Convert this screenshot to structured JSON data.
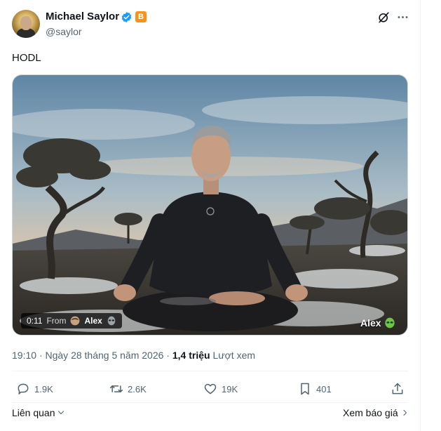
{
  "author": {
    "name": "Michael Saylor",
    "handle": "@saylor",
    "badge_letter": "B"
  },
  "tweet": {
    "text": "HODL"
  },
  "video": {
    "duration": "0:11",
    "from_label": "From",
    "from_name": "Alex",
    "watermark": "Alex"
  },
  "meta": {
    "time": "19:10",
    "separator": "·",
    "date": "Ngày 28 tháng 5 năm 2026",
    "views_count": "1,4 triệu",
    "views_label": "Lượt xem"
  },
  "actions": {
    "replies": "1.9K",
    "reposts": "2.6K",
    "likes": "19K",
    "bookmarks": "401"
  },
  "footer": {
    "related": "Liên quan",
    "quotes": "Xem báo giá"
  },
  "colors": {
    "verified": "#1d9bf0",
    "btc": "#f7931a",
    "muted": "#536471",
    "text": "#0f1419"
  }
}
